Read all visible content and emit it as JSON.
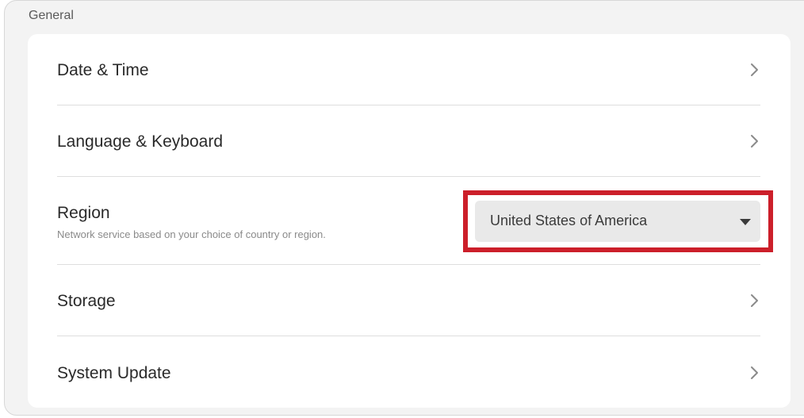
{
  "section": {
    "title": "General"
  },
  "rows": {
    "date_time": {
      "label": "Date & Time",
      "icon": "chevron-right-icon"
    },
    "language_keyboard": {
      "label": "Language & Keyboard",
      "icon": "chevron-right-icon"
    },
    "region": {
      "label": "Region",
      "description": "Network service based on your choice of country or region.",
      "selected_value": "United States of America",
      "icon": "caret-down-icon"
    },
    "storage": {
      "label": "Storage",
      "icon": "chevron-right-icon"
    },
    "system_update": {
      "label": "System Update",
      "icon": "chevron-right-icon"
    }
  },
  "colors": {
    "highlight": "#cc1f2a",
    "panel_background": "#f3f3f3",
    "card_background": "#ffffff",
    "select_background": "#e9e9e9"
  }
}
